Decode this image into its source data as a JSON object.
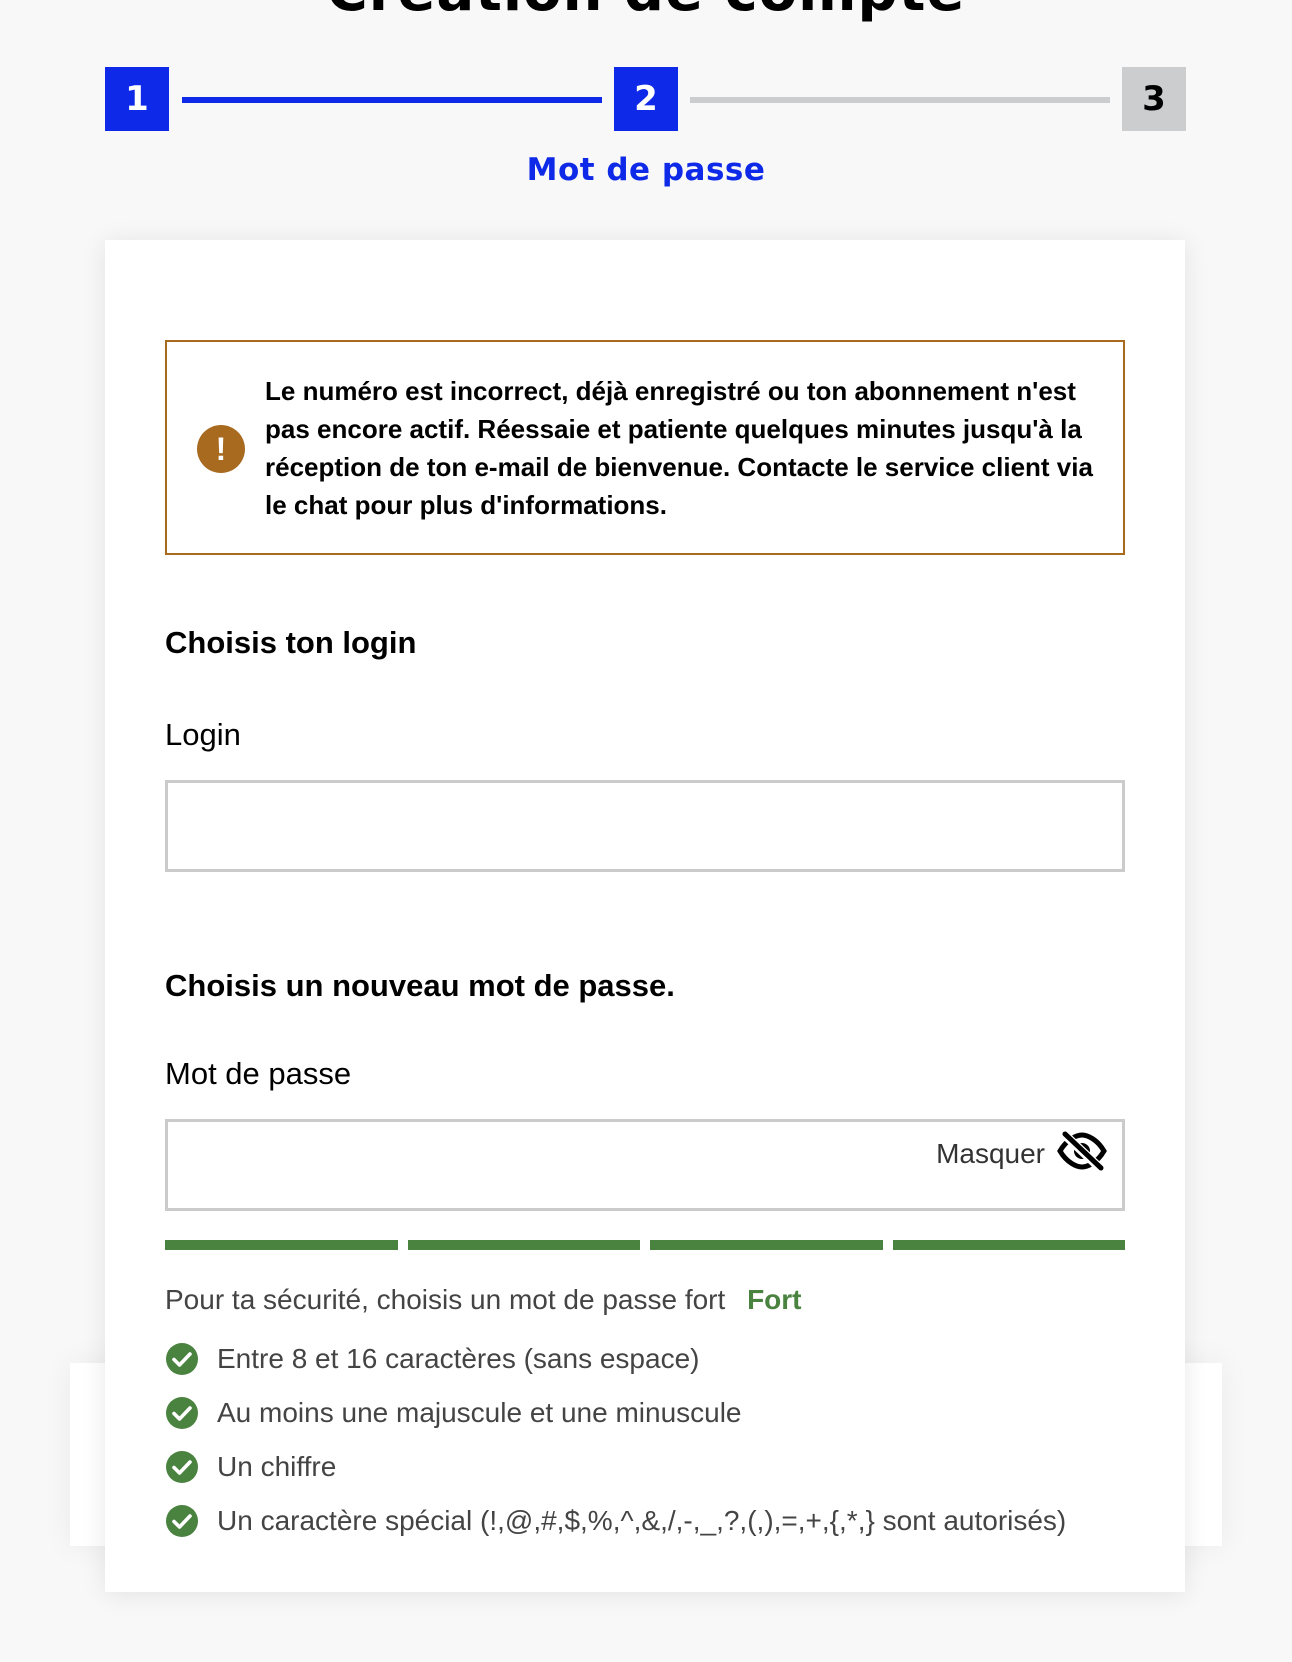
{
  "page": {
    "title": "Création de compte"
  },
  "stepper": {
    "steps": [
      {
        "number": "1",
        "state": "active"
      },
      {
        "number": "2",
        "state": "active"
      },
      {
        "number": "3",
        "state": "inactive"
      }
    ],
    "current_caption": "Mot de passe"
  },
  "alert": {
    "icon": "warning-icon",
    "message": "Le numéro est incorrect, déjà enregistré ou ton abonnement n'est pas encore actif. Réessaie et patiente quelques minutes jusqu'à la réception de ton e-mail de bienvenue. Contacte le service client via le chat pour plus d'informations."
  },
  "login_section": {
    "title": "Choisis ton login",
    "field_label": "Login",
    "value": ""
  },
  "password_section": {
    "title": "Choisis un nouveau mot de passe.",
    "field_label": "Mot de passe",
    "value": "",
    "toggle_label": "Masquer",
    "toggle_icon": "eye-slash-icon",
    "strength_bars_filled": 4,
    "strength_bars_total": 4,
    "strength_hint": "Pour ta sécurité, choisis un mot de passe fort",
    "strength_level": "Fort",
    "rules": [
      {
        "label": "Entre 8 et 16 caractères (sans espace)",
        "valid": true,
        "icon": "check-circle-icon"
      },
      {
        "label": "Au moins une majuscule et une minuscule",
        "valid": true,
        "icon": "check-circle-icon"
      },
      {
        "label": "Un chiffre",
        "valid": true,
        "icon": "check-circle-icon"
      },
      {
        "label": "Un caractère spécial (!,@,#,$,%,^,&,/,-,_,?,(,),=,+,{,*,} sont autorisés)",
        "valid": true,
        "icon": "check-circle-icon"
      }
    ]
  },
  "colors": {
    "brand_blue": "#0e2ae8",
    "step_inactive": "#cbcdce",
    "warning_brown": "#a86a1f",
    "success_green": "#4a8240",
    "input_border": "#cbcbcb",
    "page_bg": "#f8f8f8"
  }
}
